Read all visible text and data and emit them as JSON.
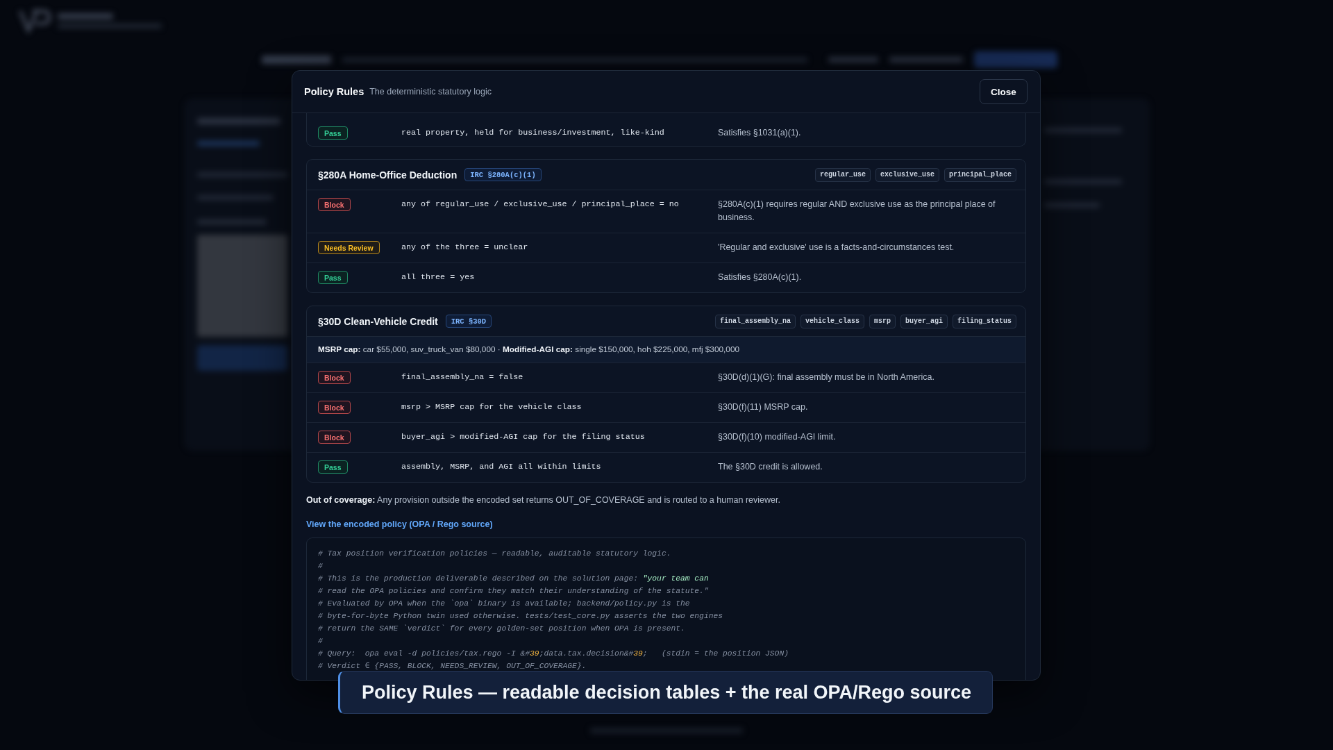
{
  "dialog": {
    "title": "Policy Rules",
    "subtitle": "The deterministic statutory logic",
    "close_label": "Close"
  },
  "sections": [
    {
      "rules": [
        {
          "kind": "pass",
          "badge": "Pass",
          "condition": "real property, held for business/investment, like-kind",
          "explanation": "Satisfies §1031(a)(1)."
        }
      ]
    },
    {
      "title": "§280A Home-Office Deduction",
      "citation": "IRC §280A(c)(1)",
      "fields": [
        "regular_use",
        "exclusive_use",
        "principal_place"
      ],
      "rules": [
        {
          "kind": "block",
          "badge": "Block",
          "condition": "any of regular_use / exclusive_use / principal_place = no",
          "explanation": "§280A(c)(1) requires regular AND exclusive use as the principal place of business."
        },
        {
          "kind": "review",
          "badge": "Needs Review",
          "condition": "any of the three = unclear",
          "explanation": "'Regular and exclusive' use is a facts-and-circumstances test."
        },
        {
          "kind": "pass",
          "badge": "Pass",
          "condition": "all three = yes",
          "explanation": "Satisfies §280A(c)(1)."
        }
      ]
    },
    {
      "title": "§30D Clean-Vehicle Credit",
      "citation": "IRC §30D",
      "fields": [
        "final_assembly_na",
        "vehicle_class",
        "msrp",
        "buyer_agi",
        "filing_status"
      ],
      "note": "**MSRP cap:** car $55,000, suv_truck_van $80,000 · **Modified-AGI cap:** single $150,000, hoh $225,000, mfj $300,000",
      "rules": [
        {
          "kind": "block",
          "badge": "Block",
          "condition": "final_assembly_na = false",
          "explanation": "§30D(d)(1)(G): final assembly must be in North America."
        },
        {
          "kind": "block",
          "badge": "Block",
          "condition": "msrp > MSRP cap for the vehicle class",
          "explanation": "§30D(f)(11) MSRP cap."
        },
        {
          "kind": "block",
          "badge": "Block",
          "condition": "buyer_agi > modified-AGI cap for the filing status",
          "explanation": "§30D(f)(10) modified-AGI limit."
        },
        {
          "kind": "pass",
          "badge": "Pass",
          "condition": "assembly, MSRP, and AGI all within limits",
          "explanation": "The §30D credit is allowed."
        }
      ]
    }
  ],
  "coverage_note": "**Out of coverage:** Any provision outside the encoded set returns OUT_OF_COVERAGE and is routed to a human reviewer.",
  "source_link": "View the encoded policy (OPA / Rego source)",
  "source_code": [
    [
      {
        "kind": "comment",
        "text": "# Tax position verification policies — readable, auditable statutory logic."
      }
    ],
    [
      {
        "kind": "comment",
        "text": "#"
      }
    ],
    [
      {
        "kind": "comment",
        "text": "# This is the production deliverable described on the solution page: "
      },
      {
        "kind": "string",
        "text": "\"your team can"
      }
    ],
    [
      {
        "kind": "comment",
        "text": "# read the OPA policies and confirm they match their understanding of the statute.\""
      }
    ],
    [
      {
        "kind": "comment",
        "text": "# Evaluated by OPA when the `opa` binary is available; backend/policy.py is the"
      }
    ],
    [
      {
        "kind": "comment",
        "text": "# byte-for-byte Python twin used otherwise. tests/test_core.py asserts the two engines"
      }
    ],
    [
      {
        "kind": "comment",
        "text": "# return the SAME `verdict` for every golden-set position when OPA is present."
      }
    ],
    [
      {
        "kind": "comment",
        "text": "#"
      }
    ],
    [
      {
        "kind": "comment",
        "text": "# Query:  opa eval -d policies/tax.rego -I &#"
      },
      {
        "kind": "number",
        "text": "39"
      },
      {
        "kind": "comment",
        "text": ";data.tax.decision&#"
      },
      {
        "kind": "number",
        "text": "39"
      },
      {
        "kind": "comment",
        "text": ";   (stdin = the position JSON)"
      }
    ],
    [
      {
        "kind": "comment",
        "text": "# Verdict ∈ {PASS, BLOCK, NEEDS_REVIEW, OUT_OF_COVERAGE}."
      }
    ]
  ],
  "caption": "Policy Rules — readable decision tables + the real OPA/Rego source"
}
